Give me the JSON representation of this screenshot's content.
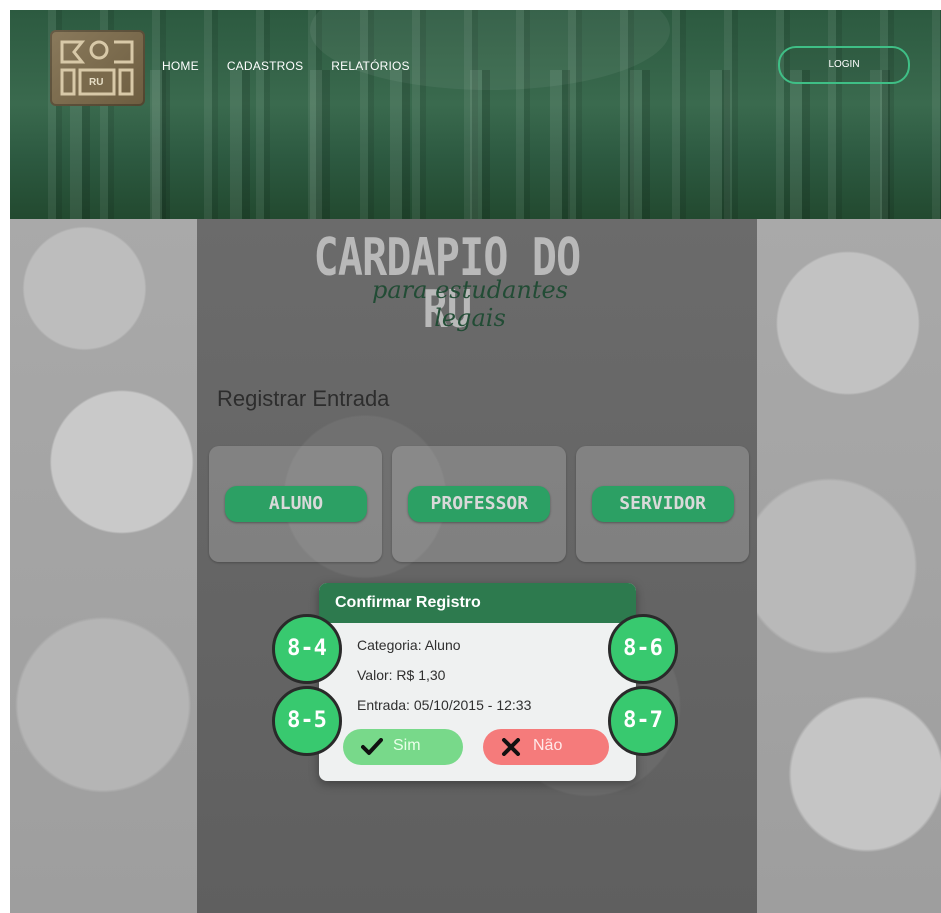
{
  "header": {
    "nav": [
      "HOME",
      "CADASTROS",
      "RELATÓRIOS"
    ],
    "login": "LOGIN",
    "logo_text": "RU"
  },
  "hero": {
    "title": "CARDAPIO DO RU",
    "subtitle": "para estudantes legais"
  },
  "section": {
    "title": "Registrar Entrada",
    "categories": [
      "ALUNO",
      "PROFESSOR",
      "SERVIDOR"
    ]
  },
  "modal": {
    "title": "Confirmar Registro",
    "categoria": "Categoria: Aluno",
    "valor": "Valor: R$ 1,30",
    "entrada": "Entrada: 05/10/2015 - 12:33",
    "confirm": "Sim",
    "cancel": "Não"
  },
  "markers": [
    "8-4",
    "8-5",
    "8-6",
    "8-7"
  ],
  "colors": {
    "header_green": "#2c5a40",
    "button_green": "#2ca064",
    "modal_header": "#2d7a4e",
    "sim": "#78d98a",
    "nao": "#f57b7b",
    "marker": "#38c96f"
  }
}
